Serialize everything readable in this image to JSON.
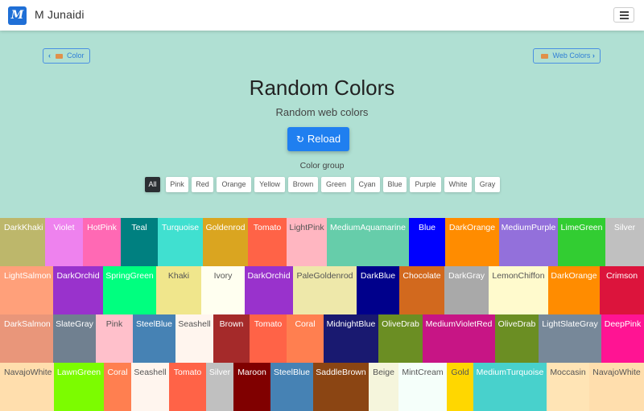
{
  "navbar": {
    "logo_text": "M",
    "brand": "M Junaidi"
  },
  "hero": {
    "back_chip": {
      "chevron": "‹",
      "label": "Color"
    },
    "next_chip": {
      "label": "Web Colors",
      "chevron": "›"
    },
    "title": "Random Colors",
    "subtitle": "Random web colors",
    "reload_icon": "↻",
    "reload_label": "Reload",
    "group_label": "Color group",
    "filters": [
      "All",
      "Pink",
      "Red",
      "Orange",
      "Yellow",
      "Brown",
      "Green",
      "Cyan",
      "Blue",
      "Purple",
      "White",
      "Gray"
    ],
    "active_filter": "All",
    "background": "#b0e0d3"
  },
  "accent_color": "#1f7ff0",
  "rows": [
    [
      {
        "name": "DarkKhaki",
        "color": "#BDB76B"
      },
      {
        "name": "Violet",
        "color": "#EE82EE"
      },
      {
        "name": "HotPink",
        "color": "#FF69B4"
      },
      {
        "name": "Teal",
        "color": "#008080"
      },
      {
        "name": "Turquoise",
        "color": "#40E0D0"
      },
      {
        "name": "Goldenrod",
        "color": "#DAA520"
      },
      {
        "name": "Tomato",
        "color": "#FF6347"
      },
      {
        "name": "LightPink",
        "color": "#FFB6C1"
      },
      {
        "name": "MediumAquamarine",
        "color": "#66CDAA"
      },
      {
        "name": "Blue",
        "color": "#0000FF"
      },
      {
        "name": "DarkOrange",
        "color": "#FF8C00"
      },
      {
        "name": "MediumPurple",
        "color": "#9370DB"
      },
      {
        "name": "LimeGreen",
        "color": "#32CD32"
      },
      {
        "name": "Silver",
        "color": "#C0C0C0"
      }
    ],
    [
      {
        "name": "LightSalmon",
        "color": "#FFA07A"
      },
      {
        "name": "DarkOrchid",
        "color": "#9932CC"
      },
      {
        "name": "SpringGreen",
        "color": "#00FF7F"
      },
      {
        "name": "Khaki",
        "color": "#F0E68C"
      },
      {
        "name": "Ivory",
        "color": "#FFFFF0"
      },
      {
        "name": "DarkOrchid",
        "color": "#9932CC"
      },
      {
        "name": "PaleGoldenrod",
        "color": "#EEE8AA"
      },
      {
        "name": "DarkBlue",
        "color": "#00008B"
      },
      {
        "name": "Chocolate",
        "color": "#D2691E"
      },
      {
        "name": "DarkGray",
        "color": "#A9A9A9"
      },
      {
        "name": "LemonChiffon",
        "color": "#FFFACD"
      },
      {
        "name": "DarkOrange",
        "color": "#FF8C00"
      },
      {
        "name": "Crimson",
        "color": "#DC143C"
      }
    ],
    [
      {
        "name": "DarkSalmon",
        "color": "#E9967A"
      },
      {
        "name": "SlateGray",
        "color": "#708090"
      },
      {
        "name": "Pink",
        "color": "#FFC0CB"
      },
      {
        "name": "SteelBlue",
        "color": "#4682B4"
      },
      {
        "name": "Seashell",
        "color": "#FFF5EE"
      },
      {
        "name": "Brown",
        "color": "#A52A2A"
      },
      {
        "name": "Tomato",
        "color": "#FF6347"
      },
      {
        "name": "Coral",
        "color": "#FF7F50"
      },
      {
        "name": "MidnightBlue",
        "color": "#191970"
      },
      {
        "name": "OliveDrab",
        "color": "#6B8E23"
      },
      {
        "name": "MediumVioletRed",
        "color": "#C71585"
      },
      {
        "name": "OliveDrab",
        "color": "#6B8E23"
      },
      {
        "name": "LightSlateGray",
        "color": "#778899"
      },
      {
        "name": "DeepPink",
        "color": "#FF1493"
      }
    ],
    [
      {
        "name": "NavajoWhite",
        "color": "#FFDEAD"
      },
      {
        "name": "LawnGreen",
        "color": "#7CFC00"
      },
      {
        "name": "Coral",
        "color": "#FF7F50"
      },
      {
        "name": "Seashell",
        "color": "#FFF5EE"
      },
      {
        "name": "Tomato",
        "color": "#FF6347"
      },
      {
        "name": "Silver",
        "color": "#C0C0C0"
      },
      {
        "name": "Maroon",
        "color": "#800000"
      },
      {
        "name": "SteelBlue",
        "color": "#4682B4"
      },
      {
        "name": "SaddleBrown",
        "color": "#8B4513"
      },
      {
        "name": "Beige",
        "color": "#F5F5DC"
      },
      {
        "name": "MintCream",
        "color": "#F5FFFA"
      },
      {
        "name": "Gold",
        "color": "#FFD700"
      },
      {
        "name": "MediumTurquoise",
        "color": "#48D1CC"
      },
      {
        "name": "Moccasin",
        "color": "#FFE4B5"
      },
      {
        "name": "NavajoWhite",
        "color": "#FFDEAD"
      }
    ]
  ]
}
